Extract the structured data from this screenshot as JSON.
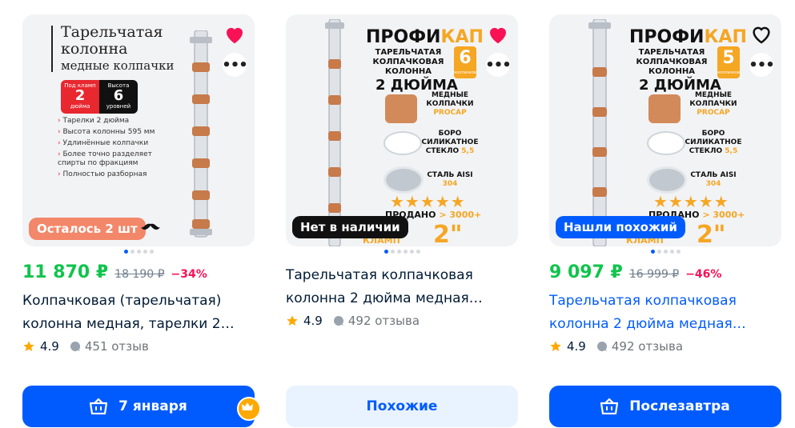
{
  "cards": [
    {
      "image": {
        "title_l1": "Тарельчатая",
        "title_l2": "колонна",
        "subtitle": "медные колпачки",
        "spec1_label": "Под кламп",
        "spec1_value": "2",
        "spec1_unit": "дюйма",
        "spec2_label": "Высота",
        "spec2_value": "6",
        "spec2_unit": "уровней",
        "bullets": [
          "Тарелки 2 дюйма",
          "Высота колонны 595 мм",
          "Удлинённые колпачки",
          "Более точно разделяет спирты по фракциям",
          "Полностью разборная"
        ]
      },
      "favorite": true,
      "badge": "Осталось 2 шт",
      "price": "11 870 ₽",
      "old_price": "18 190 ₽",
      "discount": "−34%",
      "title": "Колпачковая (тарельчатая) колонна медная, тарелки 2…",
      "rating": "4.9",
      "reviews": "451 отзыв",
      "button": "7 января"
    },
    {
      "image": {
        "brand1": "ПРОФИ",
        "brand2": "КАП",
        "level_num": "6",
        "level_word": "колпачков",
        "heading": "ТАРЕЛЬЧАТАЯ КОЛПАЧКОВАЯ КОЛОННА",
        "size": "2 ДЮЙМА",
        "f1": "МЕДНЫЕ КОЛПАЧКИ",
        "f1b": "PROCAP",
        "f2": "БОРО СИЛИКАТНОЕ СТЕКЛО",
        "f2b": "5,5",
        "f3": "СТАЛЬ AISI",
        "f3b": "304",
        "stars": "★★★★★",
        "sold": "ПРОДАНО",
        "sold_val": "> 3000+",
        "clamp": "КЛАМП",
        "inch": "2\""
      },
      "favorite": true,
      "badge": "Нет в наличии",
      "title": "Тарельчатая колпачковая колонна 2 дюйма медная…",
      "rating": "4.9",
      "reviews": "492 отзыва",
      "button": "Похожие"
    },
    {
      "image": {
        "brand1": "ПРОФИ",
        "brand2": "КАП",
        "level_num": "5",
        "level_word": "колпачков",
        "heading": "ТАРЕЛЬЧАТАЯ КОЛПАЧКОВАЯ КОЛОННА",
        "size": "2 ДЮЙМА",
        "f1": "МЕДНЫЕ КОЛПАЧКИ",
        "f1b": "PROCAP",
        "f2": "БОРО СИЛИКАТНОЕ СТЕКЛО",
        "f2b": "5,5",
        "f3": "СТАЛЬ AISI",
        "f3b": "304",
        "stars": "★★★★★",
        "sold": "ПРОДАНО",
        "sold_val": "> 3000+",
        "clamp": "КЛАМП",
        "inch": "2\""
      },
      "favorite": false,
      "badge": "Нашли похожий",
      "price": "9 097 ₽",
      "old_price": "16 999 ₽",
      "discount": "−46%",
      "title": "Тарельчатая колпачковая колонна 2 дюйма медная…",
      "rating": "4.9",
      "reviews": "492 отзыва",
      "button": "Послезавтра"
    }
  ],
  "colors": {
    "price_green": "#10c44c",
    "accent_blue": "#005bff",
    "discount_red": "#f91155",
    "favorite_red": "#f91155",
    "badge_orange": "#f3876a"
  }
}
